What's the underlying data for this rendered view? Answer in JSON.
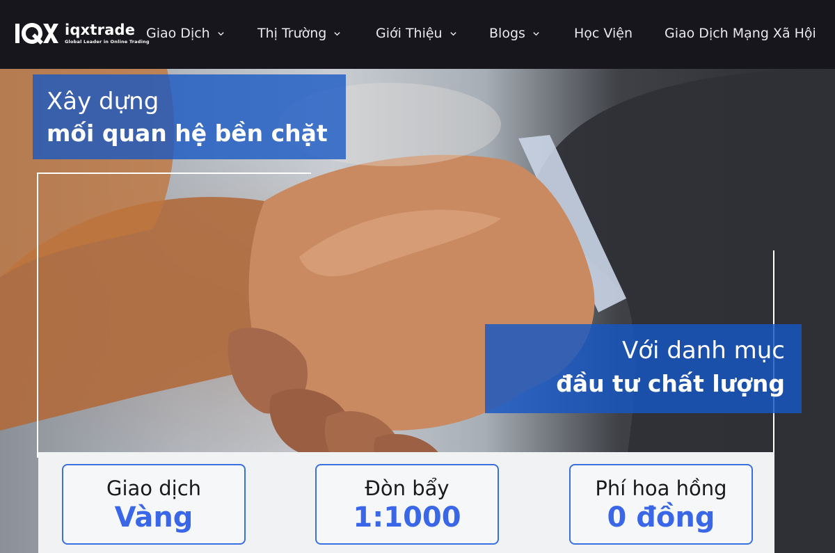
{
  "brand": {
    "name": "iqxtrade",
    "tagline": "Global Leader in Online Trading"
  },
  "nav": {
    "items": [
      {
        "label": "Giao Dịch",
        "has_dropdown": true
      },
      {
        "label": "Thị Trường",
        "has_dropdown": true
      },
      {
        "label": "Giới Thiệu",
        "has_dropdown": true
      },
      {
        "label": "Blogs",
        "has_dropdown": true
      },
      {
        "label": "Học Viện",
        "has_dropdown": false
      },
      {
        "label": "Giao Dịch Mạng Xã Hội",
        "has_dropdown": false
      }
    ]
  },
  "hero": {
    "title_line1": "Xây dựng",
    "title_line2": "mối quan hệ bền chặt",
    "subtitle_line1": "Với danh mục",
    "subtitle_line2": "đầu tư chất lượng"
  },
  "features": [
    {
      "top": "Giao dịch",
      "value": "Vàng"
    },
    {
      "top": "Đòn bẩy",
      "value": "1:1000"
    },
    {
      "top": "Phí hoa hồng",
      "value": "0 đồng"
    }
  ],
  "colors": {
    "navbar_bg": "#17161c",
    "accent_blue": "#1657c4",
    "feature_value": "#3a67e8"
  }
}
